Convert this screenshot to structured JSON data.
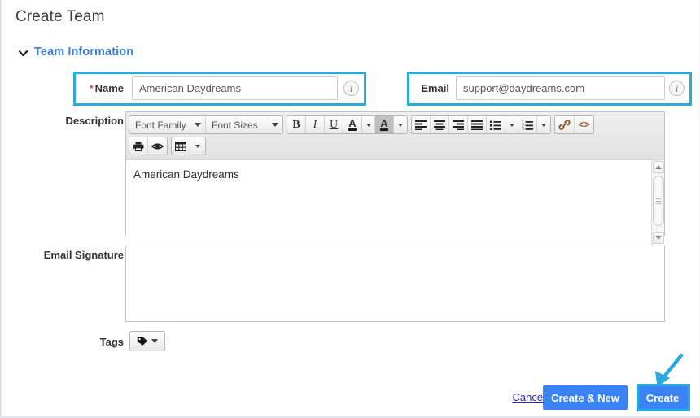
{
  "page": {
    "title": "Create Team"
  },
  "section": {
    "title": "Team Information",
    "chevron_icon": "chevron-down-icon"
  },
  "fields": {
    "name": {
      "label": "Name",
      "required_marker": "*",
      "value": "American Daydreams",
      "placeholder": "",
      "info_icon": "info-icon",
      "info_glyph": "i",
      "highlighted": true
    },
    "email": {
      "label": "Email",
      "value": "support@daydreams.com",
      "placeholder": "",
      "info_icon": "info-icon",
      "info_glyph": "i",
      "highlighted": true
    },
    "description": {
      "label": "Description",
      "content": "American Daydreams"
    },
    "email_signature": {
      "label": "Email Signature",
      "content": ""
    },
    "tags": {
      "label": "Tags",
      "icon": "tag-icon"
    }
  },
  "editor_toolbar": {
    "row1": [
      {
        "name": "font-family-select",
        "label": "Font Family",
        "type": "select"
      },
      {
        "name": "font-sizes-select",
        "label": "Font Sizes",
        "type": "select"
      },
      {
        "name": "bold-button",
        "label": "B",
        "type": "button"
      },
      {
        "name": "italic-button",
        "label": "I",
        "type": "button"
      },
      {
        "name": "underline-button",
        "label": "U",
        "type": "button"
      },
      {
        "name": "text-color-button",
        "label": "A",
        "type": "split"
      },
      {
        "name": "background-color-button",
        "label": "A",
        "type": "split",
        "pressed": true
      },
      {
        "name": "align-left-button",
        "label": "",
        "type": "icon"
      },
      {
        "name": "align-center-button",
        "label": "",
        "type": "icon"
      },
      {
        "name": "align-right-button",
        "label": "",
        "type": "icon"
      },
      {
        "name": "align-justify-button",
        "label": "",
        "type": "icon"
      },
      {
        "name": "bullet-list-button",
        "label": "",
        "type": "split-icon"
      },
      {
        "name": "numbered-list-button",
        "label": "",
        "type": "split-icon"
      },
      {
        "name": "insert-link-button",
        "label": "",
        "type": "icon"
      },
      {
        "name": "source-code-button",
        "label": "<>",
        "type": "button"
      }
    ],
    "row2": [
      {
        "name": "print-button",
        "label": "",
        "type": "icon"
      },
      {
        "name": "preview-button",
        "label": "",
        "type": "icon"
      },
      {
        "name": "table-button",
        "label": "",
        "type": "split-icon"
      }
    ]
  },
  "scrollbar": {
    "up_icon": "scroll-up-arrow-icon",
    "down_icon": "scroll-down-arrow-icon"
  },
  "footer": {
    "cancel_label": "Cancel",
    "create_new_label": "Create & New",
    "create_label": "Create",
    "create_highlighted": true
  },
  "colors": {
    "accent_button": "#3b82f6",
    "highlight_annotation": "#29abe2",
    "section_title": "#3b7ddd",
    "required_star": "#e03c31",
    "link": "#2727c4"
  }
}
